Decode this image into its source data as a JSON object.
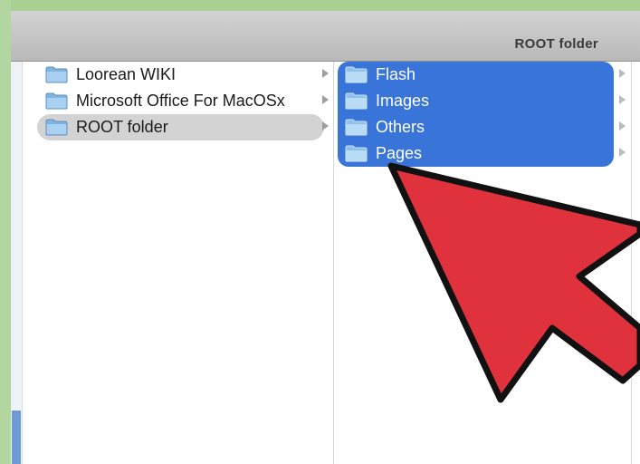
{
  "window": {
    "title": "ROOT folder"
  },
  "column_1": {
    "items": [
      {
        "label": "Loorean WIKI",
        "selected": false
      },
      {
        "label": "Microsoft Office For MacOSx",
        "selected": false
      },
      {
        "label": "ROOT folder",
        "selected": true
      }
    ]
  },
  "column_2": {
    "items": [
      {
        "label": "Flash",
        "selected": true
      },
      {
        "label": "Images",
        "selected": true
      },
      {
        "label": "Others",
        "selected": true
      },
      {
        "label": "Pages",
        "selected": true
      }
    ]
  },
  "colors": {
    "selection_blue": "#3975d9",
    "inactive_selection": "#d3d3d3",
    "pointer_red": "#e0323c",
    "folder_blue": "#8fc0ea"
  },
  "icons": {
    "folder": "folder-icon",
    "disclosure": "disclosure-arrow-icon",
    "pointer": "pointer-arrow-icon"
  }
}
